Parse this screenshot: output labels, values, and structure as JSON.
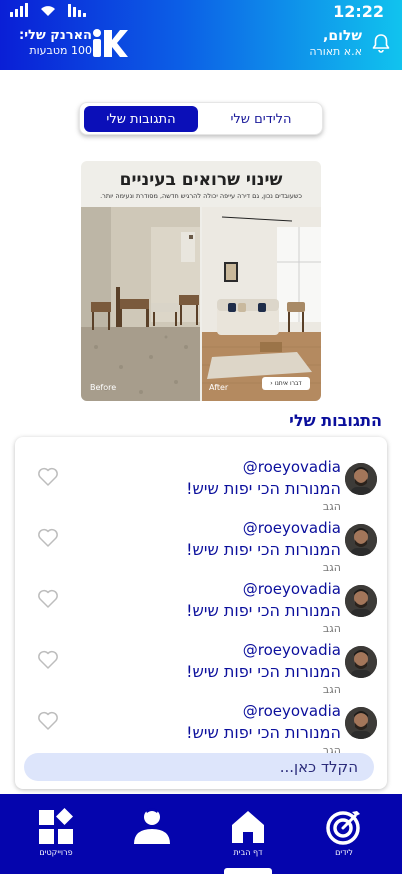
{
  "status_bar": {
    "time": "12:22"
  },
  "header": {
    "wallet_title": "הארנק שלי:",
    "wallet_amount": "100 מטבעות",
    "greeting_title": "שלום,",
    "greeting_sub": "א.א תאורה",
    "logo_icon": "k-logo-icon",
    "bell_icon": "bell-icon"
  },
  "tabs": {
    "leads_label": "הלידים שלי",
    "responses_label": "התגובות שלי",
    "active": "התגובות שלי"
  },
  "banner": {
    "title": "שינוי שרואים בעיניים",
    "subtitle": "כשעובדים נכון, גם דירה עייפה יכולה להרגיש חדשה, מסודרת ונעימה יותר.",
    "before_label": "Before",
    "after_label": "After",
    "contact_label": "דברו איתנו"
  },
  "section": {
    "title": "התגובות שלי"
  },
  "responses": [
    {
      "user": "@roeyovadia",
      "text": "המנורות הכי יפות שיש!",
      "sub": "הגב"
    },
    {
      "user": "@roeyovadia",
      "text": "המנורות הכי יפות שיש!",
      "sub": "הגב"
    },
    {
      "user": "@roeyovadia",
      "text": "המנורות הכי יפות שיש!",
      "sub": "הגב"
    },
    {
      "user": "@roeyovadia",
      "text": "המנורות הכי יפות שיש!",
      "sub": "הגב"
    },
    {
      "user": "@roeyovadia",
      "text": "המנורות הכי יפות שיש!",
      "sub": "הגב"
    }
  ],
  "reply": {
    "placeholder": "הקלד כאן..."
  },
  "nav": {
    "leads": "לידים",
    "home": "דף הבית",
    "profile": "",
    "projects": "פרוייקטים"
  },
  "colors": {
    "primary": "#0505ad",
    "accent_text": "#0b0f9c",
    "header_gradient_start": "#0a1fd6",
    "header_gradient_end": "#11c3ee",
    "input_bg": "#dde5fb"
  }
}
